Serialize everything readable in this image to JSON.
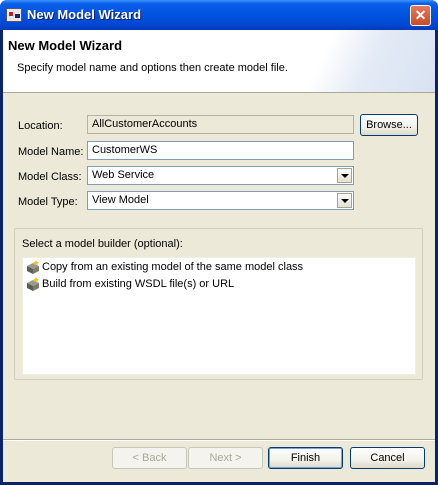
{
  "window": {
    "title": "New Model Wizard",
    "close_glyph": "✕"
  },
  "banner": {
    "title": "New Model Wizard",
    "description": "Specify model name and options then create model file."
  },
  "form": {
    "location_label": "Location:",
    "location_value": "AllCustomerAccounts",
    "browse_label": "Browse...",
    "model_name_label": "Model Name:",
    "model_name_value": "CustomerWS",
    "model_class_label": "Model Class:",
    "model_class_value": "Web Service",
    "model_type_label": "Model Type:",
    "model_type_value": "View Model"
  },
  "builder": {
    "label": "Select a model builder (optional):",
    "items": [
      {
        "label": "Copy from an existing model of the same model class",
        "icon": "model-builder-icon"
      },
      {
        "label": "Build from existing WSDL file(s) or URL",
        "icon": "model-builder-icon"
      }
    ]
  },
  "footer": {
    "back_label": "< Back",
    "next_label": "Next >",
    "finish_label": "Finish",
    "cancel_label": "Cancel"
  },
  "colors": {
    "titlebar": "#0054e3",
    "dialog_bg": "#ece9d8",
    "field_border": "#7f9db9",
    "button_border": "#003c74"
  }
}
